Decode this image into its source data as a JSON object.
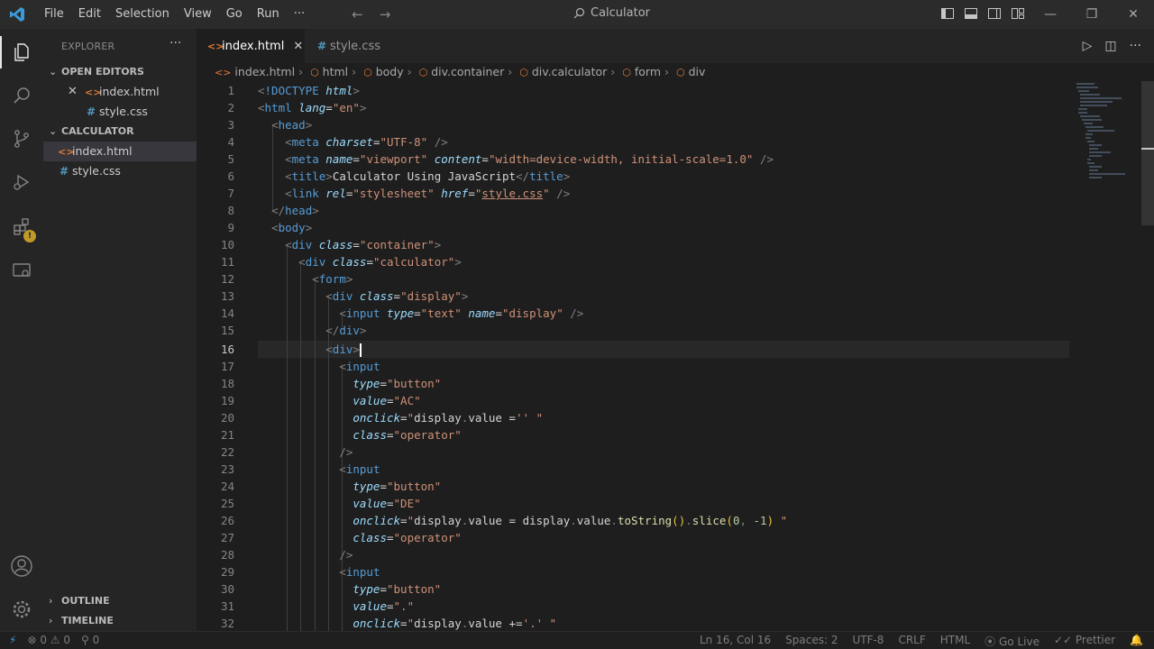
{
  "titlebar": {
    "menu": [
      "File",
      "Edit",
      "Selection",
      "View",
      "Go",
      "Run",
      "···"
    ],
    "search_text": "Calculator",
    "controls": [
      "—",
      "❐",
      "✕"
    ]
  },
  "sidebar": {
    "title": "EXPLORER",
    "more": "···",
    "open_editors_label": "OPEN EDITORS",
    "open_editors": [
      {
        "name": "index.html",
        "type": "html"
      },
      {
        "name": "style.css",
        "type": "css"
      }
    ],
    "folder_label": "CALCULATOR",
    "files": [
      {
        "name": "index.html",
        "type": "html"
      },
      {
        "name": "style.css",
        "type": "css"
      }
    ],
    "outline_label": "OUTLINE",
    "timeline_label": "TIMELINE"
  },
  "tabs": [
    {
      "name": "index.html",
      "active": true
    },
    {
      "name": "style.css",
      "active": false
    }
  ],
  "breadcrumbs": [
    "index.html",
    "html",
    "body",
    "div.container",
    "div.calculator",
    "form",
    "div"
  ],
  "editor": {
    "current_line": 16,
    "line_numbers": [
      "1",
      "2",
      "3",
      "4",
      "5",
      "6",
      "7",
      "8",
      "9",
      "10",
      "11",
      "12",
      "13",
      "14",
      "15",
      "16",
      "17",
      "18",
      "19",
      "20",
      "21",
      "22",
      "23",
      "24",
      "25",
      "26",
      "27",
      "28",
      "29",
      "30",
      "31",
      "32"
    ]
  },
  "statusbar": {
    "errors": "0",
    "warnings": "0",
    "ports": "0",
    "position": "Ln 16, Col 16",
    "spaces": "Spaces: 2",
    "encoding": "UTF-8",
    "eol": "CRLF",
    "language": "HTML",
    "golive": "Go Live",
    "prettier": "Prettier"
  },
  "colors": {
    "accent_blue": "#3a9ad9",
    "html_icon": "#e37933",
    "css_icon": "#519aba"
  }
}
